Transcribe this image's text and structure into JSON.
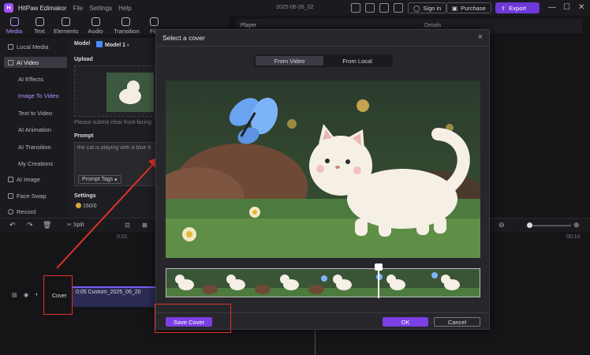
{
  "app": {
    "name": "HitPaw Edimakor",
    "menus": [
      "File",
      "Settings",
      "Help"
    ],
    "document_title": "2025-06-26_02",
    "sign_in": "Sign in",
    "purchase": "Purchase",
    "export": "Export"
  },
  "tools": [
    {
      "label": "Media",
      "active": true
    },
    {
      "label": "Text"
    },
    {
      "label": "Elements"
    },
    {
      "label": "Audio"
    },
    {
      "label": "Transition"
    },
    {
      "label": "Filt"
    }
  ],
  "sidenav": {
    "local_media": "Local Media",
    "ai_video": "AI Video",
    "ai_effects": "AI Effects",
    "image_to_video": "Image To Video",
    "text_to_video": "Text to Video",
    "ai_animation": "AI Animation",
    "ai_transition": "AI Transition",
    "my_creations": "My Creations",
    "ai_image": "AI Image",
    "face_swap": "Face Swap",
    "record": "Record"
  },
  "panel": {
    "model_label": "Model",
    "model_value": "Model 1",
    "upload_label": "Upload",
    "upload_hint": "Please submit clear front-facing",
    "prompt_label": "Prompt",
    "prompt_text": "the cat is playing with a blue b",
    "prompt_tags": "Prompt Tags",
    "settings_label": "Settings",
    "credits": "160/0"
  },
  "player": {
    "label": "Player",
    "details": "Details"
  },
  "timeline": {
    "split": "Split",
    "time_start": "0:01",
    "time_end": "00:10",
    "clip_label": "0:05 Custom_2025_06_20",
    "cover_label": "Cover"
  },
  "modal": {
    "title": "Select a cover",
    "tab_from_video": "From Video",
    "tab_from_local": "From Local",
    "save_cover": "Save Cover",
    "ok": "OK",
    "cancel": "Cancel"
  },
  "colors": {
    "accent": "#7b3fe4",
    "highlight": "#e0322a"
  }
}
